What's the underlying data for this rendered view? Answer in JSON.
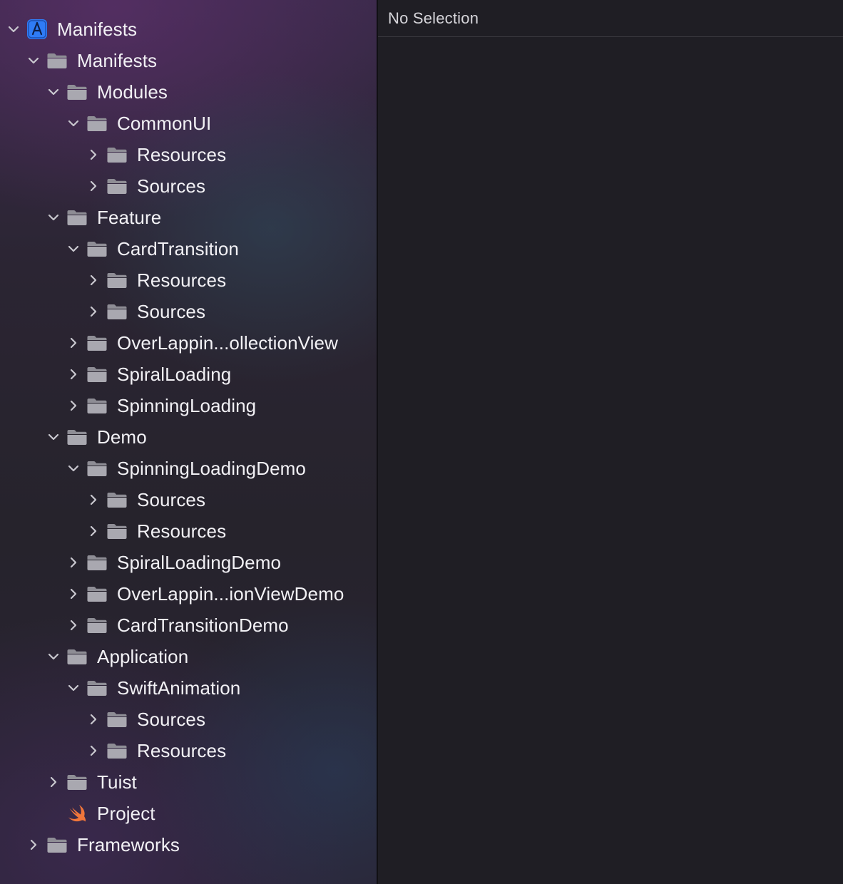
{
  "editor": {
    "title": "No Selection"
  },
  "tree": [
    {
      "label": "Manifests",
      "depth": 0,
      "state": "expanded",
      "icon": "xcode-project-icon"
    },
    {
      "label": "Manifests",
      "depth": 1,
      "state": "expanded",
      "icon": "folder-icon"
    },
    {
      "label": "Modules",
      "depth": 2,
      "state": "expanded",
      "icon": "folder-icon"
    },
    {
      "label": "CommonUI",
      "depth": 3,
      "state": "expanded",
      "icon": "folder-icon"
    },
    {
      "label": "Resources",
      "depth": 4,
      "state": "collapsed",
      "icon": "folder-icon"
    },
    {
      "label": "Sources",
      "depth": 4,
      "state": "collapsed",
      "icon": "folder-icon"
    },
    {
      "label": "Feature",
      "depth": 2,
      "state": "expanded",
      "icon": "folder-icon"
    },
    {
      "label": "CardTransition",
      "depth": 3,
      "state": "expanded",
      "icon": "folder-icon"
    },
    {
      "label": "Resources",
      "depth": 4,
      "state": "collapsed",
      "icon": "folder-icon"
    },
    {
      "label": "Sources",
      "depth": 4,
      "state": "collapsed",
      "icon": "folder-icon"
    },
    {
      "label": "OverLappin...ollectionView",
      "depth": 3,
      "state": "collapsed",
      "icon": "folder-icon"
    },
    {
      "label": "SpiralLoading",
      "depth": 3,
      "state": "collapsed",
      "icon": "folder-icon"
    },
    {
      "label": "SpinningLoading",
      "depth": 3,
      "state": "collapsed",
      "icon": "folder-icon"
    },
    {
      "label": "Demo",
      "depth": 2,
      "state": "expanded",
      "icon": "folder-icon"
    },
    {
      "label": "SpinningLoadingDemo",
      "depth": 3,
      "state": "expanded",
      "icon": "folder-icon"
    },
    {
      "label": "Sources",
      "depth": 4,
      "state": "collapsed",
      "icon": "folder-icon"
    },
    {
      "label": "Resources",
      "depth": 4,
      "state": "collapsed",
      "icon": "folder-icon"
    },
    {
      "label": "SpiralLoadingDemo",
      "depth": 3,
      "state": "collapsed",
      "icon": "folder-icon"
    },
    {
      "label": "OverLappin...ionViewDemo",
      "depth": 3,
      "state": "collapsed",
      "icon": "folder-icon"
    },
    {
      "label": "CardTransitionDemo",
      "depth": 3,
      "state": "collapsed",
      "icon": "folder-icon"
    },
    {
      "label": "Application",
      "depth": 2,
      "state": "expanded",
      "icon": "folder-icon"
    },
    {
      "label": "SwiftAnimation",
      "depth": 3,
      "state": "expanded",
      "icon": "folder-icon"
    },
    {
      "label": "Sources",
      "depth": 4,
      "state": "collapsed",
      "icon": "folder-icon"
    },
    {
      "label": "Resources",
      "depth": 4,
      "state": "collapsed",
      "icon": "folder-icon"
    },
    {
      "label": "Tuist",
      "depth": 2,
      "state": "collapsed",
      "icon": "folder-icon"
    },
    {
      "label": "Project",
      "depth": 2,
      "state": "leaf",
      "icon": "swift-file-icon"
    },
    {
      "label": "Frameworks",
      "depth": 1,
      "state": "collapsed",
      "icon": "folder-icon"
    }
  ],
  "colors": {
    "folder": "#a9a8b0",
    "folder_tab": "#8e8d95",
    "chevron": "#c9c8cf",
    "project_icon_bg": "#2f7cf6",
    "swift_orange": "#f0763b"
  }
}
